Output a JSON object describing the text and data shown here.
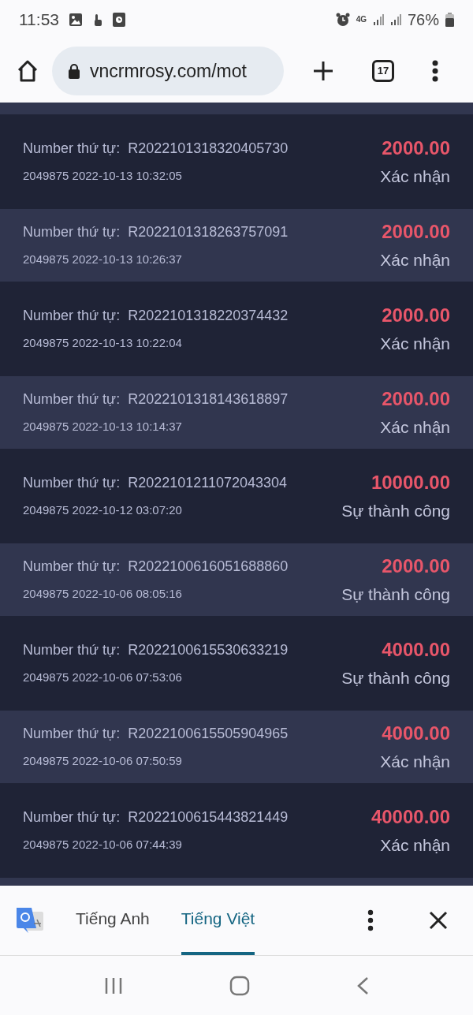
{
  "status_bar": {
    "time": "11:53",
    "network": "4G",
    "battery": "76%"
  },
  "browser": {
    "url": "vncrmrosy.com/mot",
    "tab_count": "17"
  },
  "orders": [
    {
      "label": "Number thứ tự:",
      "number": "R2022101318320405730",
      "meta": "2049875 2022-10-13 10:32:05",
      "amount": "2000.00",
      "status": "Xác nhận"
    },
    {
      "label": "Number thứ tự:",
      "number": "R2022101318263757091",
      "meta": "2049875 2022-10-13 10:26:37",
      "amount": "2000.00",
      "status": "Xác nhận"
    },
    {
      "label": "Number thứ tự:",
      "number": "R2022101318220374432",
      "meta": "2049875 2022-10-13 10:22:04",
      "amount": "2000.00",
      "status": "Xác nhận"
    },
    {
      "label": "Number thứ tự:",
      "number": "R2022101318143618897",
      "meta": "2049875 2022-10-13 10:14:37",
      "amount": "2000.00",
      "status": "Xác nhận"
    },
    {
      "label": "Number thứ tự:",
      "number": "R2022101211072043304",
      "meta": "2049875 2022-10-12 03:07:20",
      "amount": "10000.00",
      "status": "Sự thành công"
    },
    {
      "label": "Number thứ tự:",
      "number": "R2022100616051688860",
      "meta": "2049875 2022-10-06 08:05:16",
      "amount": "2000.00",
      "status": "Sự thành công"
    },
    {
      "label": "Number thứ tự:",
      "number": "R2022100615530633219",
      "meta": "2049875 2022-10-06 07:53:06",
      "amount": "4000.00",
      "status": "Sự thành công"
    },
    {
      "label": "Number thứ tự:",
      "number": "R2022100615505904965",
      "meta": "2049875 2022-10-06 07:50:59",
      "amount": "4000.00",
      "status": "Xác nhận"
    },
    {
      "label": "Number thứ tự:",
      "number": "R2022100615443821449",
      "meta": "2049875 2022-10-06 07:44:39",
      "amount": "40000.00",
      "status": "Xác nhận"
    }
  ],
  "translate_bar": {
    "tabs": [
      {
        "label": "Tiếng Anh",
        "selected": false
      },
      {
        "label": "Tiếng Việt",
        "selected": true
      }
    ]
  }
}
